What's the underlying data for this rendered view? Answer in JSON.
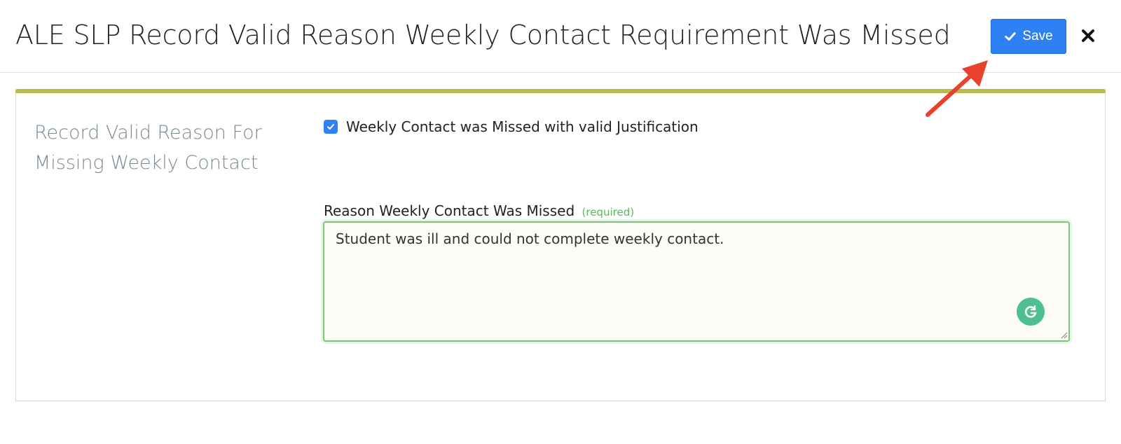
{
  "modal": {
    "title": "ALE SLP Record Valid Reason Weekly Contact Requirement Was Missed",
    "save_label": "Save"
  },
  "section": {
    "label": "Record Valid Reason For Missing Weekly Contact"
  },
  "checkbox": {
    "label": "Weekly Contact was Missed with valid Justification",
    "checked": true
  },
  "reason_field": {
    "label": "Reason Weekly Contact Was Missed",
    "required_text": "(required)",
    "value": "Student was ill and could not complete weekly contact."
  },
  "colors": {
    "primary": "#2f80f3",
    "accent_bar": "#b8bd4d",
    "valid_green": "#7cc576",
    "annotation_arrow": "#e8412c"
  },
  "icons": {
    "save": "check-icon",
    "close": "close-icon",
    "grammarly": "grammarly-icon",
    "annotation": "annotation-arrow-icon"
  }
}
